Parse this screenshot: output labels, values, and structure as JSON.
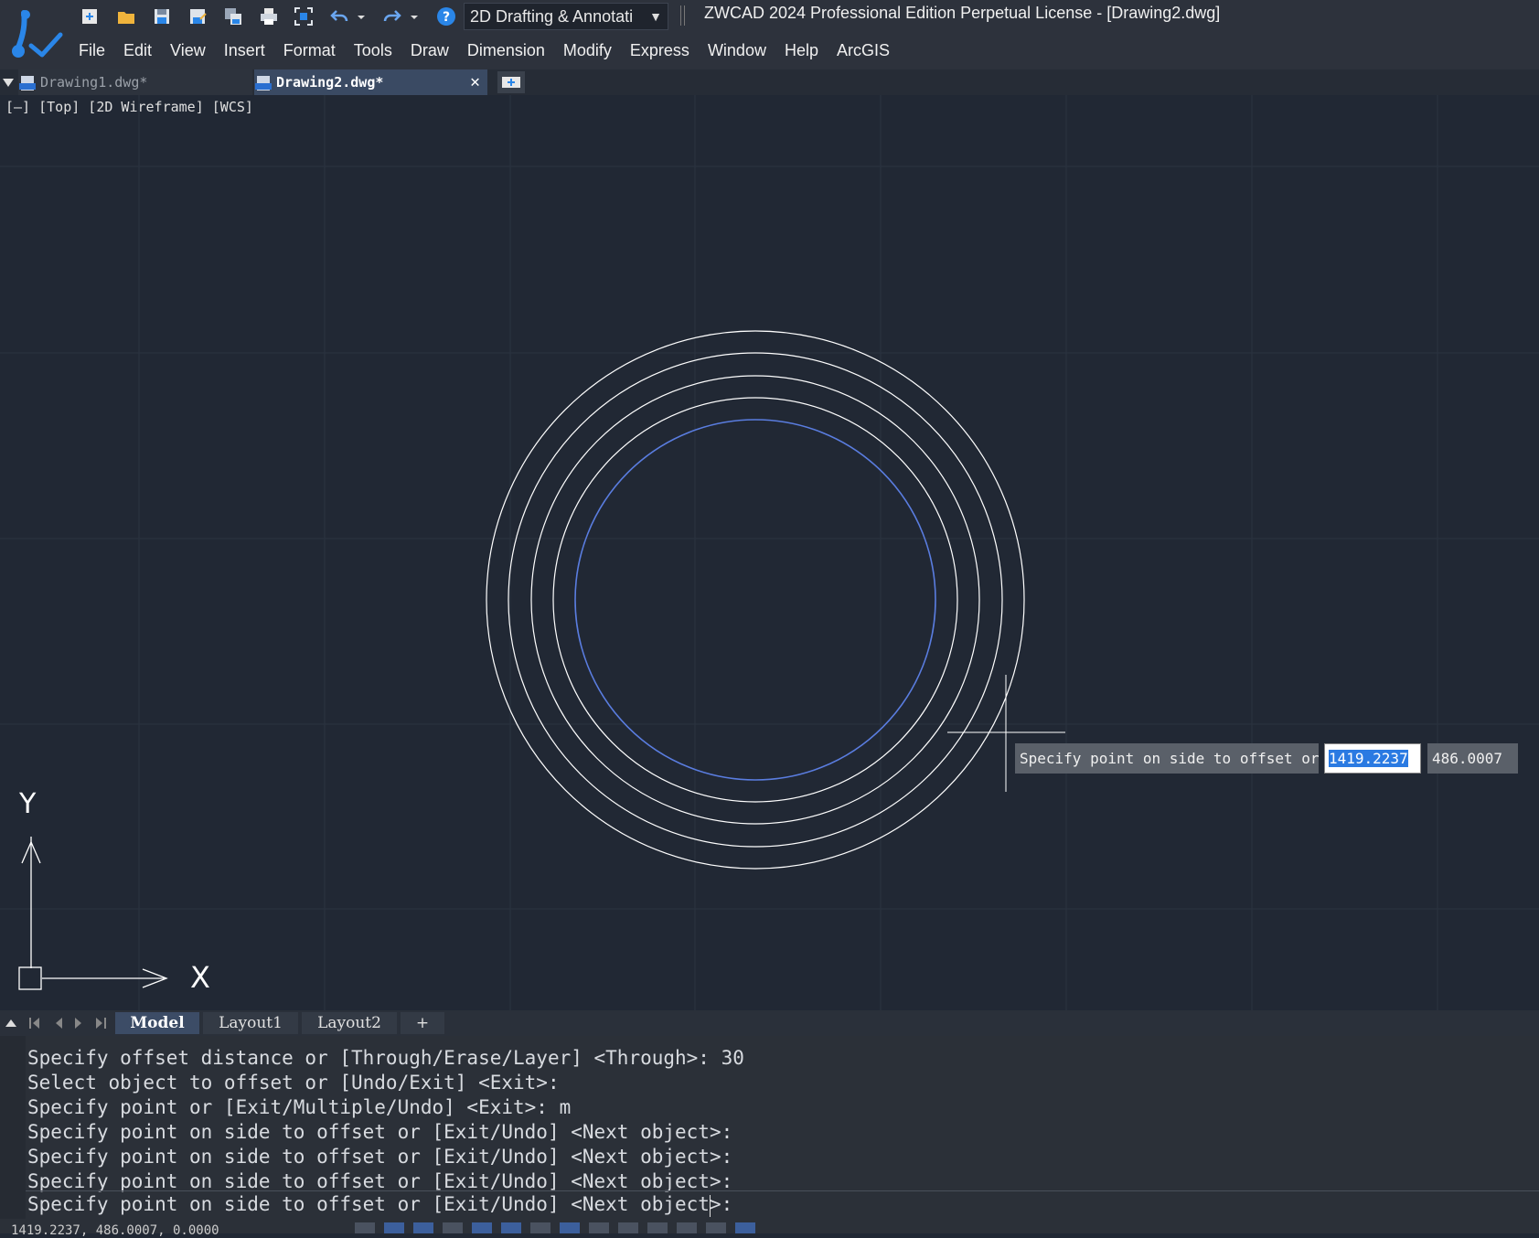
{
  "app": {
    "title": "ZWCAD 2024 Professional Edition Perpetual License - [Drawing2.dwg]",
    "workspace": "2D Drafting & Annotati"
  },
  "quick_access": [
    {
      "name": "new-icon"
    },
    {
      "name": "open-icon"
    },
    {
      "name": "save-icon"
    },
    {
      "name": "save-as-icon"
    },
    {
      "name": "multi-save-icon"
    },
    {
      "name": "print-icon"
    },
    {
      "name": "zoom-extents-icon"
    },
    {
      "name": "undo-icon"
    },
    {
      "name": "undo-dropdown-icon"
    },
    {
      "name": "redo-icon"
    },
    {
      "name": "redo-dropdown-icon"
    },
    {
      "name": "help-icon"
    }
  ],
  "menu": [
    "File",
    "Edit",
    "View",
    "Insert",
    "Format",
    "Tools",
    "Draw",
    "Dimension",
    "Modify",
    "Express",
    "Window",
    "Help",
    "ArcGIS"
  ],
  "doc_tabs": [
    {
      "label": "Drawing1.dwg*",
      "active": false
    },
    {
      "label": "Drawing2.dwg*",
      "active": true
    }
  ],
  "viewport": {
    "label": "[—] [Top] [2D Wireframe] [WCS]",
    "ucs_x": "X",
    "ucs_y": "Y",
    "circles_color": "#ffffff",
    "selected_circle_color": "#5a7de0"
  },
  "dynamic_input": {
    "prompt": "Specify point on side to offset or",
    "x_value": "1419.2237",
    "y_value": "486.0007"
  },
  "layout_tabs": [
    "Model",
    "Layout1",
    "Layout2",
    "+"
  ],
  "command_history": [
    "Specify offset distance or [Through/Erase/Layer] <Through>: 30",
    "Select object to offset or [Undo/Exit] <Exit>:",
    "Specify point or [Exit/Multiple/Undo] <Exit>: m",
    "Specify point on side to offset or [Exit/Undo] <Next object>:",
    "Specify point on side to offset or [Exit/Undo] <Next object>:",
    "Specify point on side to offset or [Exit/Undo] <Next object>:"
  ],
  "command_input": "Specify point on side to offset or [Exit/Undo] <Next object>:",
  "status": {
    "coords": "1419.2237, 486.0007, 0.0000"
  }
}
